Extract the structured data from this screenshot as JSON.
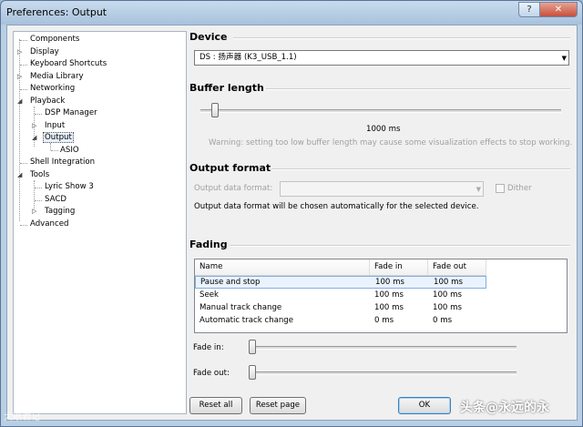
{
  "window": {
    "title": "Preferences: Output"
  },
  "titlebar": {
    "help_icon": "?",
    "close_icon": "✕"
  },
  "tree": {
    "items": [
      {
        "label": "Components"
      },
      {
        "label": "Display"
      },
      {
        "label": "Keyboard Shortcuts"
      },
      {
        "label": "Media Library"
      },
      {
        "label": "Networking"
      },
      {
        "label": "Playback"
      },
      {
        "label": "DSP Manager"
      },
      {
        "label": "Input"
      },
      {
        "label": "Output"
      },
      {
        "label": "ASIO"
      },
      {
        "label": "Shell Integration"
      },
      {
        "label": "Tools"
      },
      {
        "label": "Lyric Show 3"
      },
      {
        "label": "SACD"
      },
      {
        "label": "Tagging"
      },
      {
        "label": "Advanced"
      }
    ],
    "selected": "Output"
  },
  "device": {
    "title": "Device",
    "value": "DS : 扬声器 (K3_USB_1.1)"
  },
  "buffer": {
    "title": "Buffer length",
    "value_label": "1000 ms",
    "level_fraction": 0.03,
    "warning": "Warning: setting too low buffer length may cause some visualization effects to stop working."
  },
  "output_format": {
    "title": "Output format",
    "field_label": "Output data format:",
    "field_value": "",
    "dither_label": "Dither",
    "note": "Output data format will be chosen automatically for the selected device."
  },
  "fading": {
    "title": "Fading",
    "columns": [
      "Name",
      "Fade in",
      "Fade out"
    ],
    "rows": [
      {
        "name": "Pause and stop",
        "fade_in": "100 ms",
        "fade_out": "100 ms"
      },
      {
        "name": "Seek",
        "fade_in": "100 ms",
        "fade_out": "100 ms"
      },
      {
        "name": "Manual track change",
        "fade_in": "100 ms",
        "fade_out": "100 ms"
      },
      {
        "name": "Automatic track change",
        "fade_in": "0 ms",
        "fade_out": "0 ms"
      }
    ],
    "fade_in_label": "Fade in:",
    "fade_out_label": "Fade out:"
  },
  "buttons": {
    "reset_all": "Reset all",
    "reset_page": "Reset page",
    "ok": "OK"
  },
  "watermarks": {
    "left": "大眼君记",
    "right": "头条@永远的永"
  }
}
